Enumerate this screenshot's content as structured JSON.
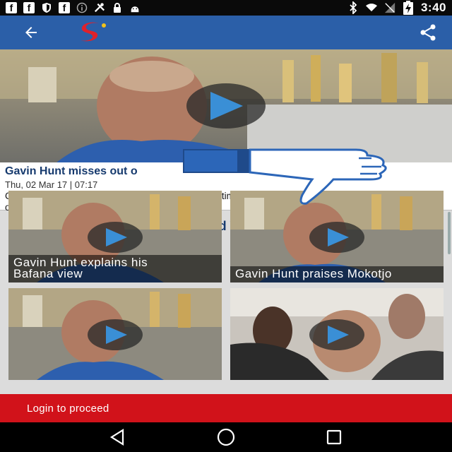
{
  "status_bar": {
    "time": "3:40",
    "notification_icons": [
      "facebook-icon",
      "facebook-icon",
      "shield-icon",
      "facebook-icon",
      "info-circle-icon",
      "tools-icon",
      "lock-icon",
      "android-icon"
    ],
    "fb_letter": "f",
    "system_icons": [
      "bluetooth-icon",
      "wifi-icon",
      "no-signal-icon",
      "battery-charging-icon"
    ]
  },
  "app_bar": {
    "background": "#2b5fa8",
    "back_icon": "arrow-left-icon",
    "logo": "supersport-s-logo",
    "share_icon": "share-icon"
  },
  "article": {
    "headline": "Gavin Hunt misses out o",
    "date": "Thu, 02 Mar 17 | 07:17",
    "summary_line1": "Coach Gavin Hunt mentions that this is the second time he has missed out",
    "summary_line2": "on being named as Bafana Bafana coach."
  },
  "related": {
    "title": "Related Videos",
    "videos": [
      {
        "caption_line1": "Gavin Hunt explains his",
        "caption_line2": "Bafana view"
      },
      {
        "caption_line1": "Gavin Hunt praises Mokotjo",
        "caption_line2": ""
      },
      {
        "caption_line1": "",
        "caption_line2": ""
      },
      {
        "caption_line1": "",
        "caption_line2": ""
      }
    ]
  },
  "login_banner": {
    "label": "Login to proceed",
    "background": "#d1121a"
  },
  "nav_bar": {
    "buttons": [
      "back-triangle-icon",
      "home-circle-icon",
      "recents-square-icon"
    ]
  },
  "colors": {
    "accent_blue": "#2b5fa8",
    "title_navy": "#163a6e",
    "play_blue": "#3a8fd6"
  }
}
